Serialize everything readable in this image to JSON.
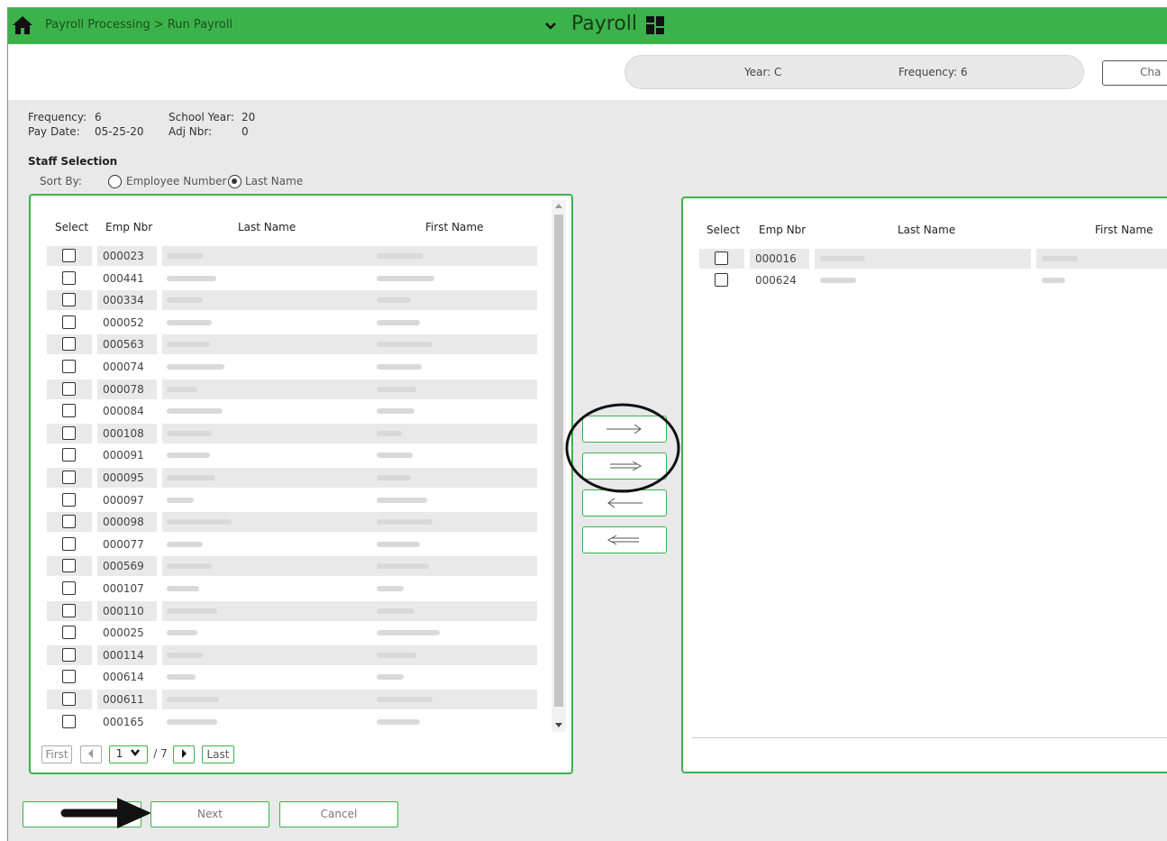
{
  "topbar": {
    "breadcrumb": "Payroll Processing > Run Payroll",
    "app_title": "Payroll"
  },
  "context": {
    "year_label": "Year: C",
    "frequency_label": "Frequency: 6",
    "change_button": "Cha"
  },
  "info": {
    "frequency_label": "Frequency:",
    "frequency_value": "6",
    "school_year_label": "School Year:",
    "school_year_value": "20",
    "pay_date_label": "Pay Date:",
    "pay_date_value": "05-25-20",
    "adj_nbr_label": "Adj Nbr:",
    "adj_nbr_value": "0"
  },
  "staff_selection": {
    "title": "Staff Selection",
    "sort_by_label": "Sort By:",
    "options": [
      "Employee Number",
      "Last Name"
    ],
    "selected": "Last Name"
  },
  "left_table": {
    "headers": {
      "select": "Select",
      "emp": "Emp Nbr",
      "last": "Last Name",
      "first": "First Name"
    },
    "rows": [
      "000023",
      "000441",
      "000334",
      "000052",
      "000563",
      "000074",
      "000078",
      "000084",
      "000108",
      "000091",
      "000095",
      "000097",
      "000098",
      "000077",
      "000569",
      "000107",
      "000110",
      "000025",
      "000114",
      "000614",
      "000611",
      "000165"
    ]
  },
  "pager": {
    "first": "First",
    "last": "Last",
    "page": "1",
    "total": "/ 7"
  },
  "right_table": {
    "headers": {
      "select": "Select",
      "emp": "Emp Nbr",
      "last": "Last Name",
      "first": "First Name"
    },
    "rows": [
      "000016",
      "000624"
    ]
  },
  "move_buttons": [
    "move-right",
    "move-all-right",
    "move-left",
    "move-all-left"
  ],
  "footer": {
    "next": "Next",
    "cancel": "Cancel"
  },
  "colors": {
    "accent": "#3bb34a"
  }
}
